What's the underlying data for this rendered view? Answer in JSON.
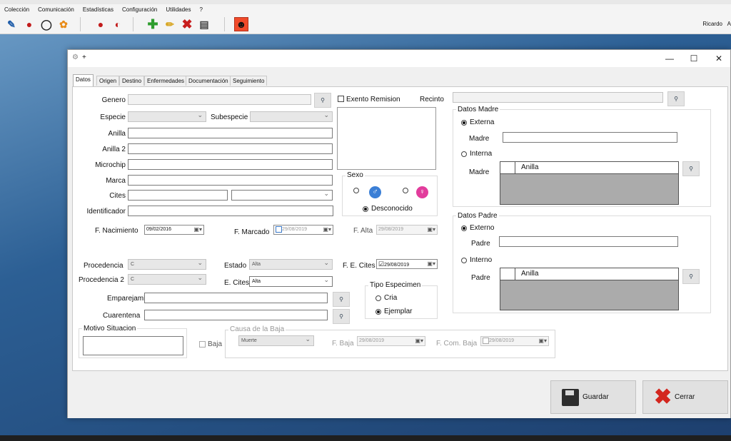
{
  "app": {
    "menu": [
      "Colección",
      "Comunicación",
      "Estadísticas",
      "Configuración",
      "Utilidades",
      "?"
    ],
    "user": "Ricardo",
    "user_extra": "A"
  },
  "dialog": {
    "title": "+",
    "tabs": [
      "Datos",
      "Origen",
      "Destino",
      "Enfermedades",
      "Documentación",
      "Seguimiento"
    ],
    "labels": {
      "genero": "Genero",
      "especie": "Especie",
      "subespecie": "Subespecie",
      "anilla": "Anilla",
      "anilla2": "Anilla 2",
      "microchip": "Microchip",
      "marca": "Marca",
      "cites": "Cites",
      "identificador": "Identificador",
      "f_nacimiento": "F. Nacimiento",
      "f_marcado": "F. Marcado",
      "f_alta": "F. Alta",
      "procedencia": "Procedencia",
      "procedencia2": "Procedencia 2",
      "estado": "Estado",
      "e_cites": "E. Cites",
      "f_e_cites": "F. E. Cites",
      "emparejamiento": "Emparejamiento",
      "cuarentena": "Cuarentena",
      "exento_remision": "Exento Remision",
      "recinto": "Recinto"
    },
    "values": {
      "f_nacimiento": "09/02/2016",
      "f_marcado": "29/08/2019",
      "f_alta": "29/08/2019",
      "procedencia": "C",
      "procedencia2": "C",
      "estado": "Alta",
      "e_cites": "Alta",
      "f_e_cites": "29/08/2019"
    },
    "sexo": {
      "title": "Sexo",
      "desconocido": "Desconocido"
    },
    "tipo_especimen": {
      "title": "Tipo Especimen",
      "cria": "Cria",
      "ejemplar": "Ejemplar"
    },
    "datos_madre": {
      "title": "Datos Madre",
      "externa": "Externa",
      "madre_label": "Madre",
      "interna": "Interna",
      "madre_grid_label": "Madre",
      "grid_col": "Anilla"
    },
    "datos_padre": {
      "title": "Datos Padre",
      "externo": "Externo",
      "padre_label": "Padre",
      "interno": "Interno",
      "padre_grid_label": "Padre",
      "grid_col": "Anilla"
    },
    "motivo_situacion": "Motivo Situacion",
    "baja": "Baja",
    "causa_baja": {
      "title": "Causa de la Baja",
      "value": "Muerte",
      "f_baja": "F. Baja",
      "f_baja_value": "29/08/2019",
      "f_com_baja": "F. Com. Baja",
      "f_com_baja_value": "29/08/2019"
    },
    "buttons": {
      "guardar": "Guardar",
      "cerrar": "Cerrar"
    }
  }
}
